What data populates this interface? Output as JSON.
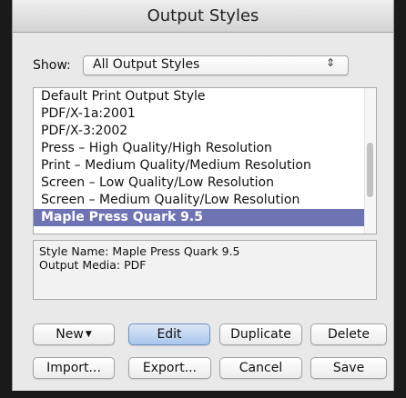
{
  "window": {
    "title": "Output Styles"
  },
  "show": {
    "label": "Show:",
    "selected": "All Output Styles",
    "arrows_icon": "⇕"
  },
  "styles_list": {
    "items": [
      "Default Print Output Style",
      "PDF/X-1a:2001",
      "PDF/X-3:2002",
      "Press – High Quality/High Resolution",
      "Print – Medium Quality/Medium Resolution",
      "Screen – Low Quality/Low Resolution",
      "Screen – Medium Quality/Low Resolution",
      "Maple Press Quark 9.5"
    ],
    "selected_index": 7
  },
  "info": {
    "style_name_line": "Style Name: Maple Press Quark 9.5",
    "output_media_line": "Output Media: PDF"
  },
  "buttons": {
    "new": "New",
    "new_caret": "▼",
    "edit": "Edit",
    "duplicate": "Duplicate",
    "delete": "Delete",
    "import": "Import...",
    "export": "Export...",
    "cancel": "Cancel",
    "save": "Save"
  },
  "colors": {
    "selection": "#6e73b3",
    "default_button": "#a9c6ec"
  }
}
